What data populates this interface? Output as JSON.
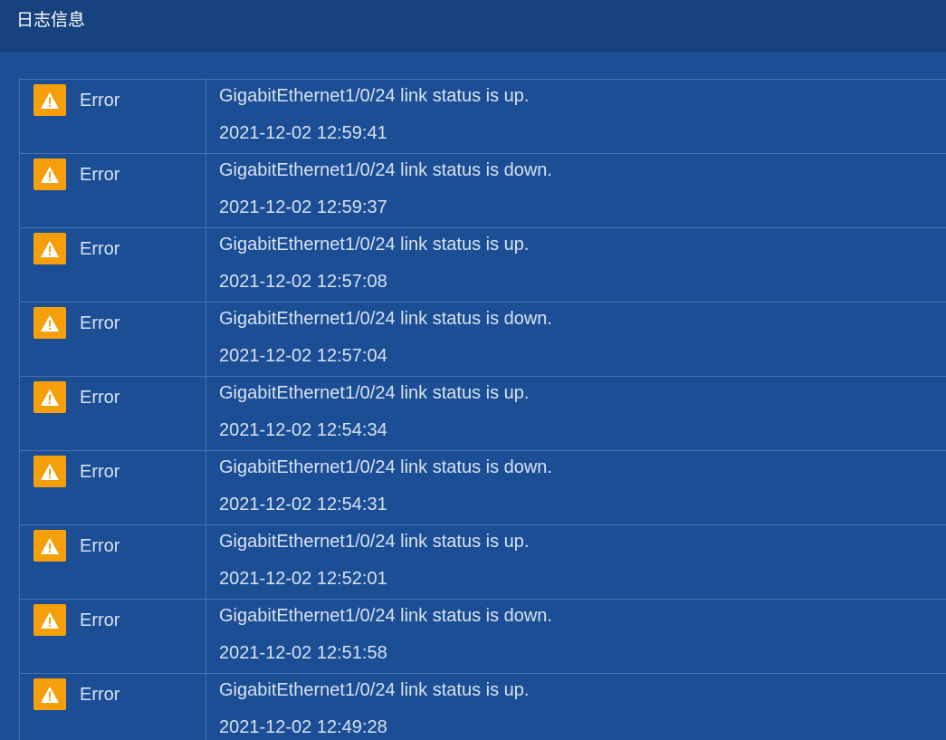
{
  "panel": {
    "title": "日志信息"
  },
  "colors": {
    "background": "#1b4e95",
    "header": "#16437f",
    "warning_icon": "#f5a00b",
    "text": "#d8e2f0",
    "border": "#4a73ad"
  },
  "logs": [
    {
      "icon": "warning-icon",
      "level": "Error",
      "message": "GigabitEthernet1/0/24 link status is up.",
      "time": "2021-12-02 12:59:41"
    },
    {
      "icon": "warning-icon",
      "level": "Error",
      "message": "GigabitEthernet1/0/24 link status is down.",
      "time": "2021-12-02 12:59:37"
    },
    {
      "icon": "warning-icon",
      "level": "Error",
      "message": "GigabitEthernet1/0/24 link status is up.",
      "time": "2021-12-02 12:57:08"
    },
    {
      "icon": "warning-icon",
      "level": "Error",
      "message": "GigabitEthernet1/0/24 link status is down.",
      "time": "2021-12-02 12:57:04"
    },
    {
      "icon": "warning-icon",
      "level": "Error",
      "message": "GigabitEthernet1/0/24 link status is up.",
      "time": "2021-12-02 12:54:34"
    },
    {
      "icon": "warning-icon",
      "level": "Error",
      "message": "GigabitEthernet1/0/24 link status is down.",
      "time": "2021-12-02 12:54:31"
    },
    {
      "icon": "warning-icon",
      "level": "Error",
      "message": "GigabitEthernet1/0/24 link status is up.",
      "time": "2021-12-02 12:52:01"
    },
    {
      "icon": "warning-icon",
      "level": "Error",
      "message": "GigabitEthernet1/0/24 link status is down.",
      "time": "2021-12-02 12:51:58"
    },
    {
      "icon": "warning-icon",
      "level": "Error",
      "message": "GigabitEthernet1/0/24 link status is up.",
      "time": "2021-12-02 12:49:28"
    }
  ]
}
